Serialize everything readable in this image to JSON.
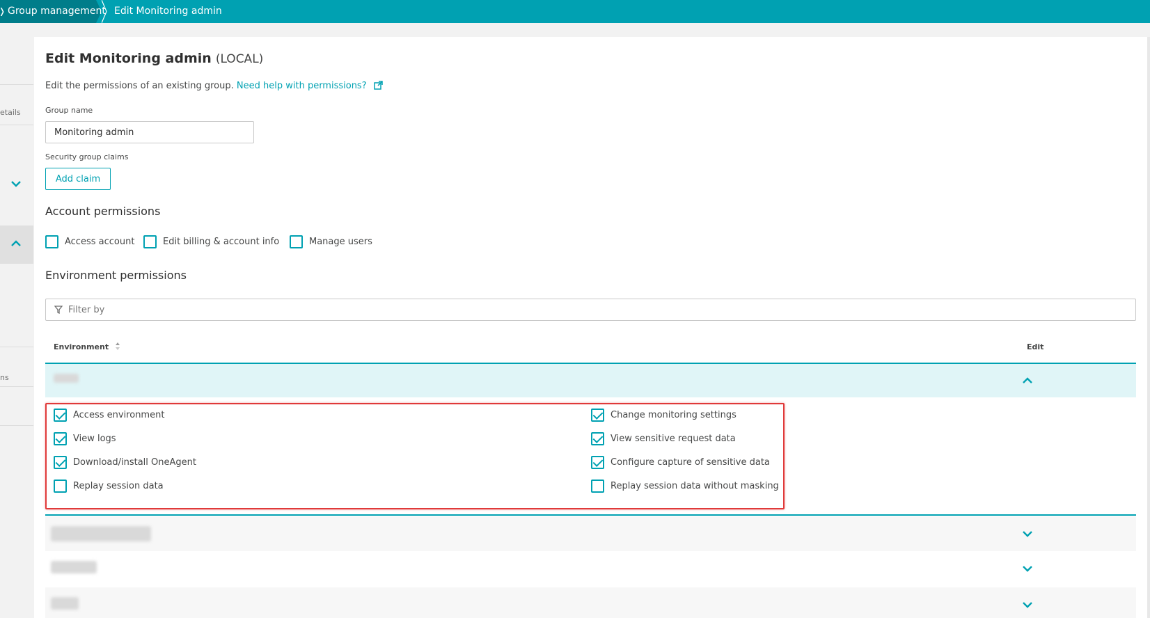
{
  "breadcrumb": {
    "parent": "Group management",
    "current": "Edit Monitoring admin"
  },
  "leftnav": {
    "label_details": "etails",
    "label_ns": "ns"
  },
  "page": {
    "title": "Edit Monitoring admin",
    "title_tag": "(LOCAL)",
    "description": "Edit the permissions of an existing group.",
    "help_link": "Need help with permissions?"
  },
  "form": {
    "group_name_label": "Group name",
    "group_name_value": "Monitoring admin",
    "claims_label": "Security group claims",
    "add_claim_label": "Add claim"
  },
  "account_permissions": {
    "heading": "Account permissions",
    "items": [
      {
        "label": "Access account",
        "checked": false
      },
      {
        "label": "Edit billing & account info",
        "checked": false
      },
      {
        "label": "Manage users",
        "checked": false
      }
    ]
  },
  "environment_permissions": {
    "heading": "Environment permissions",
    "filter_placeholder": "Filter by",
    "columns": {
      "environment": "Environment",
      "edit": "Edit"
    },
    "permissions_left": [
      {
        "label": "Access environment",
        "checked": true
      },
      {
        "label": "View logs",
        "checked": true
      },
      {
        "label": "Download/install OneAgent",
        "checked": true
      },
      {
        "label": "Replay session data",
        "checked": false
      }
    ],
    "permissions_right": [
      {
        "label": "Change monitoring settings",
        "checked": true
      },
      {
        "label": "View sensitive request data",
        "checked": true
      },
      {
        "label": "Configure capture of sensitive data",
        "checked": true
      },
      {
        "label": "Replay session data without masking",
        "checked": false
      }
    ]
  },
  "colors": {
    "accent": "#00a1b2",
    "accent_dark": "#007d8a",
    "highlight_border": "#e03a3a",
    "expanded_row_bg": "#e0f5f7"
  }
}
